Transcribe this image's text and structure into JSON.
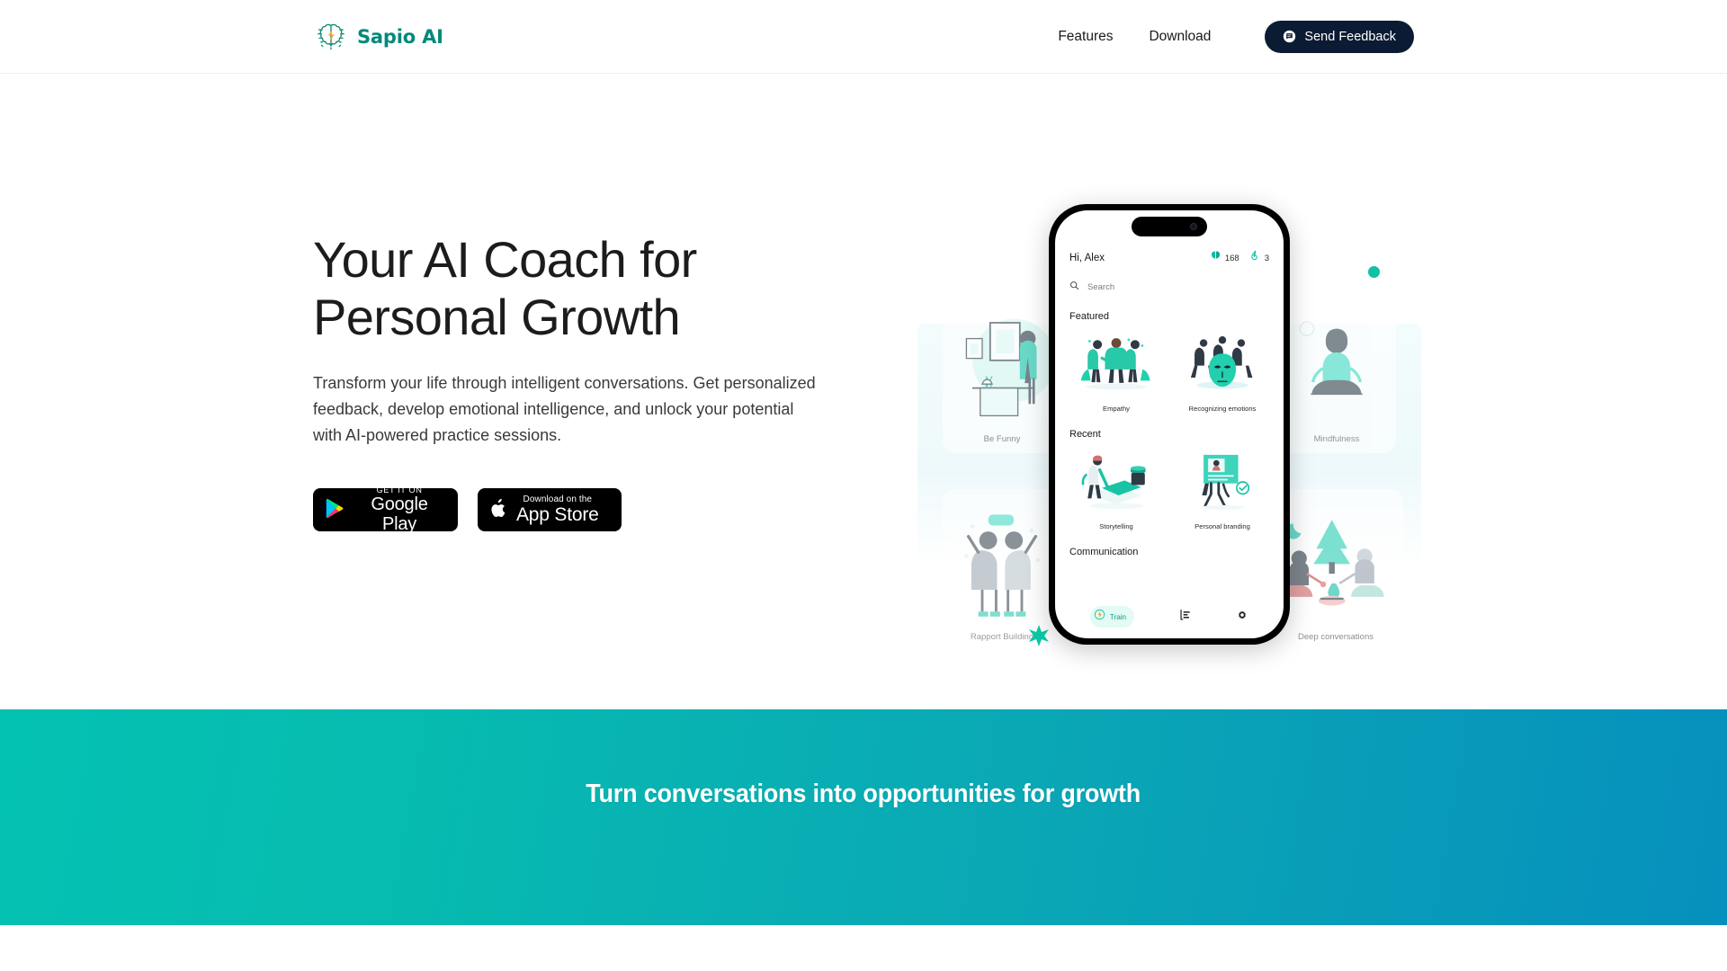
{
  "header": {
    "brand_name": "Sapio AI",
    "brand_icon": "brain-lightning-logo",
    "nav_items": [
      {
        "label": "Features",
        "name": "features"
      },
      {
        "label": "Download",
        "name": "download"
      }
    ],
    "feedback_button": {
      "label": "Send Feedback",
      "icon": "chat-bubble-icon",
      "bg_color": "#0b1b33",
      "text_color": "#ffffff"
    }
  },
  "hero": {
    "title": "Your AI Coach for\nPersonal Growth",
    "subtitle": "Transform your life through intelligent conversations. Get personalized feedback, develop emotional intelligence, and unlock your potential with AI-powered practice sessions.",
    "google_play": {
      "small": "GET IT ON",
      "big": "Google Play",
      "icon": "google-play-icon"
    },
    "app_store": {
      "small": "Download on the",
      "big": "App Store",
      "icon": "apple-logo-icon"
    }
  },
  "phone_app": {
    "greeting": "Hi, Alex",
    "stats": [
      {
        "icon": "brain-icon",
        "value": "168"
      },
      {
        "icon": "flame-icon",
        "value": "3"
      }
    ],
    "search_placeholder": "Search",
    "sections": [
      {
        "title": "Featured",
        "cards": [
          {
            "label": "Empathy",
            "art": "three-people-illustration"
          },
          {
            "label": "Recognizing emotions",
            "art": "mask-faces-illustration"
          }
        ]
      },
      {
        "title": "Recent",
        "cards": [
          {
            "label": "Storytelling",
            "art": "person-writing-illustration"
          },
          {
            "label": "Personal branding",
            "art": "profile-card-illustration"
          }
        ]
      },
      {
        "title": "Communication",
        "cards": []
      }
    ],
    "tabs": [
      {
        "label": "Train",
        "icon": "brain-lightning-icon",
        "active": true
      },
      {
        "label": "",
        "icon": "bar-chart-icon",
        "active": false
      },
      {
        "label": "",
        "icon": "gear-icon",
        "active": false
      }
    ]
  },
  "showcase_ghost_cards": [
    {
      "label": "Be Funny",
      "art": "person-at-desk-illustration"
    },
    {
      "label": "Mindfulness",
      "art": "meditating-person-illustration"
    },
    {
      "label": "Rapport Building",
      "art": "two-friends-hugging-illustration"
    },
    {
      "label": "Deep conversations",
      "art": "campfire-night-illustration"
    }
  ],
  "banner": {
    "text": "Turn conversations into opportunities for growth",
    "gradient_from": "#06bcb0",
    "gradient_to": "#0690bd",
    "text_color": "#ffffff"
  },
  "theme": {
    "teal": "#0fc2a3",
    "brand_green": "#00897b",
    "navy": "#0b1b33",
    "orange": "#f5a623"
  }
}
